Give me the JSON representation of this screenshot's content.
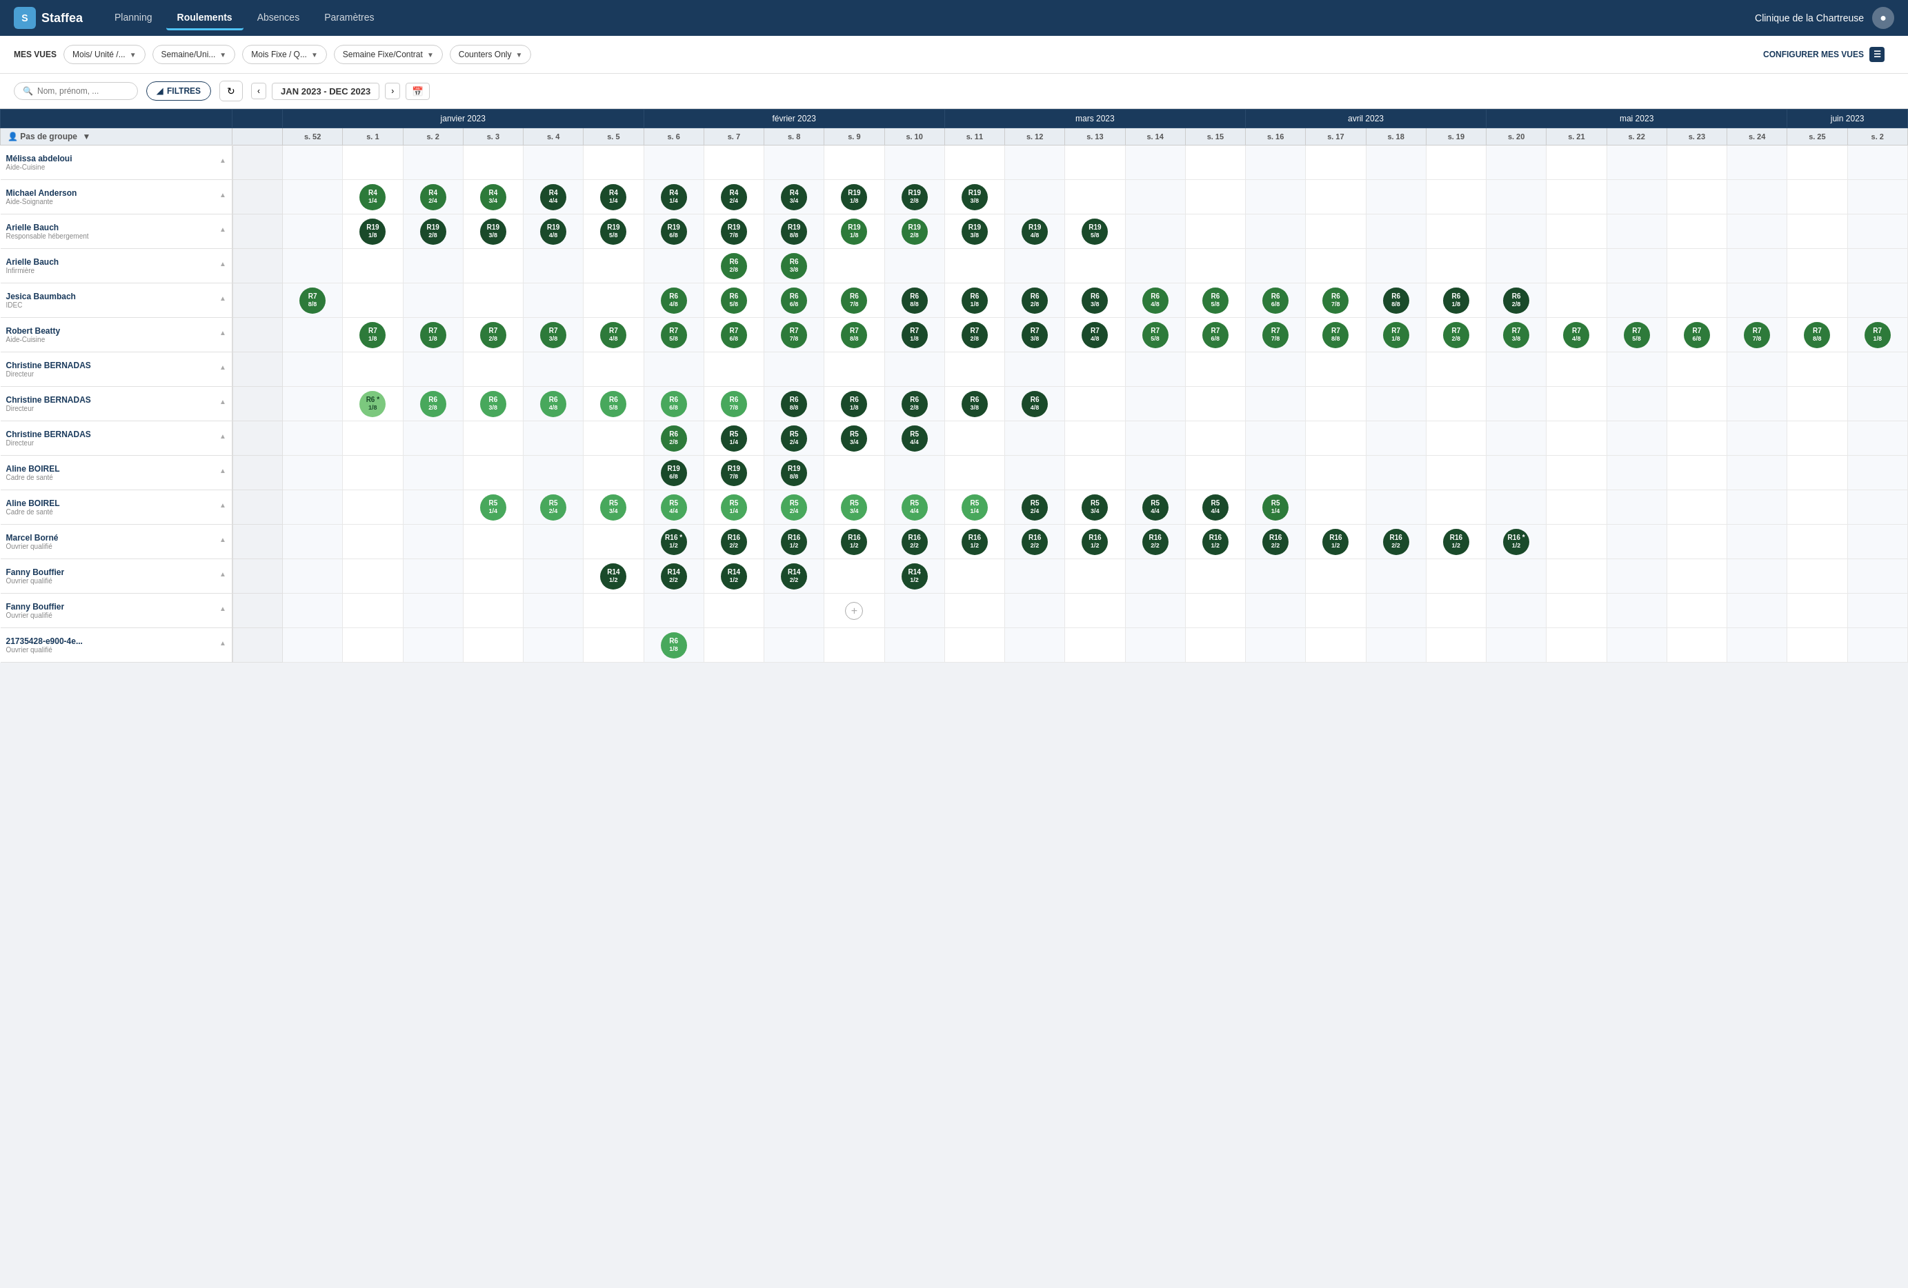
{
  "app": {
    "logo": "S",
    "logo_full": "Staffea"
  },
  "navbar": {
    "links": [
      "Planning",
      "Roulements",
      "Absences",
      "Paramètres"
    ],
    "active_link": "Roulements",
    "clinic": "Clinique de la Chartreuse"
  },
  "toolbar": {
    "label": "MES VUES",
    "dropdowns": [
      "Mois/ Unité /...",
      "Semaine/Uni...",
      "Mois Fixe / Q...",
      "Semaine Fixe/Contrat",
      "Counters Only"
    ],
    "configure_label": "CONFIGURER MES VUES"
  },
  "searchbar": {
    "placeholder": "Nom, prénom, ...",
    "filter_label": "FILTRES",
    "date_range": "JAN 2023 - DEC 2023"
  },
  "group": {
    "label": "Pas de groupe"
  },
  "months": [
    {
      "label": "janvier 2023",
      "span": 6
    },
    {
      "label": "février 2023",
      "span": 5
    },
    {
      "label": "mars 2023",
      "span": 5
    },
    {
      "label": "avril 2023",
      "span": 4
    },
    {
      "label": "mai 2023",
      "span": 5
    },
    {
      "label": "juin 2023",
      "span": 5
    }
  ],
  "weeks": [
    "s. 52",
    "s. 1",
    "s. 2",
    "s. 3",
    "s. 4",
    "s. 5",
    "s. 6",
    "s. 7",
    "s. 8",
    "s. 9",
    "s. 10",
    "s. 11",
    "s. 12",
    "s. 13",
    "s. 14",
    "s. 15",
    "s. 16",
    "s. 17",
    "s. 18",
    "s. 19",
    "s. 20",
    "s. 21",
    "s. 22",
    "s. 23",
    "s. 24",
    "s. 25",
    "s. 2"
  ],
  "employees": [
    {
      "name": "Mélissa abdeloui",
      "role": "Aide-Cuisine",
      "shifts": {}
    },
    {
      "name": "Michael Anderson",
      "role": "Aide-Soignante",
      "shifts": {
        "1": {
          "label": "R4",
          "frac": "1/4",
          "color": "medium"
        },
        "2": {
          "label": "R4",
          "frac": "2/4",
          "color": "medium"
        },
        "3": {
          "label": "R4",
          "frac": "3/4",
          "color": "medium"
        },
        "4": {
          "label": "R4",
          "frac": "4/4",
          "color": "dark"
        },
        "5": {
          "label": "R4",
          "frac": "1/4",
          "color": "dark"
        },
        "6": {
          "label": "R4",
          "frac": "1/4",
          "color": "dark"
        },
        "7": {
          "label": "R4",
          "frac": "2/4",
          "color": "dark"
        },
        "8": {
          "label": "R4",
          "frac": "3/4",
          "color": "dark"
        },
        "9": {
          "label": "R19",
          "frac": "1/8",
          "color": "dark"
        },
        "10": {
          "label": "R19",
          "frac": "2/8",
          "color": "dark"
        },
        "11": {
          "label": "R19",
          "frac": "3/8",
          "color": "dark"
        }
      }
    },
    {
      "name": "Arielle Bauch",
      "role": "Responsable hébergement",
      "shifts": {
        "1": {
          "label": "R19",
          "frac": "1/8",
          "color": "dark"
        },
        "2": {
          "label": "R19",
          "frac": "2/8",
          "color": "dark"
        },
        "3": {
          "label": "R19",
          "frac": "3/8",
          "color": "dark"
        },
        "4": {
          "label": "R19",
          "frac": "4/8",
          "color": "dark"
        },
        "5": {
          "label": "R19",
          "frac": "5/8",
          "color": "dark"
        },
        "6": {
          "label": "R19",
          "frac": "6/8",
          "color": "dark"
        },
        "7": {
          "label": "R19",
          "frac": "7/8",
          "color": "dark"
        },
        "8": {
          "label": "R19",
          "frac": "8/8",
          "color": "dark"
        },
        "9": {
          "label": "R19",
          "frac": "1/8",
          "color": "medium"
        },
        "10": {
          "label": "R19",
          "frac": "2/8",
          "color": "medium"
        },
        "11": {
          "label": "R19",
          "frac": "3/8",
          "color": "dark"
        },
        "12": {
          "label": "R19",
          "frac": "4/8",
          "color": "dark"
        },
        "13": {
          "label": "R19",
          "frac": "5/8",
          "color": "dark"
        }
      }
    },
    {
      "name": "Arielle Bauch",
      "role": "Infirmière",
      "shifts": {
        "7": {
          "label": "R6",
          "frac": "2/8",
          "color": "medium"
        },
        "8": {
          "label": "R6",
          "frac": "3/8",
          "color": "medium"
        }
      }
    },
    {
      "name": "Jesica Baumbach",
      "role": "IDEC",
      "shifts": {
        "0": {
          "label": "R7",
          "frac": "8/8",
          "color": "medium"
        },
        "6": {
          "label": "R6",
          "frac": "4/8",
          "color": "medium"
        },
        "7": {
          "label": "R6",
          "frac": "5/8",
          "color": "medium"
        },
        "8": {
          "label": "R6",
          "frac": "6/8",
          "color": "medium"
        },
        "9": {
          "label": "R6",
          "frac": "7/8",
          "color": "medium"
        },
        "10": {
          "label": "R6",
          "frac": "8/8",
          "color": "dark"
        },
        "11": {
          "label": "R6",
          "frac": "1/8",
          "color": "dark"
        },
        "12": {
          "label": "R6",
          "frac": "2/8",
          "color": "dark"
        },
        "13": {
          "label": "R6",
          "frac": "3/8",
          "color": "dark"
        },
        "14": {
          "label": "R6",
          "frac": "4/8",
          "color": "medium"
        },
        "15": {
          "label": "R6",
          "frac": "5/8",
          "color": "medium"
        },
        "16": {
          "label": "R6",
          "frac": "6/8",
          "color": "medium"
        },
        "17": {
          "label": "R6",
          "frac": "7/8",
          "color": "medium"
        },
        "18": {
          "label": "R6",
          "frac": "8/8",
          "color": "dark"
        },
        "19": {
          "label": "R6",
          "frac": "1/8",
          "color": "dark"
        },
        "20": {
          "label": "R6",
          "frac": "2/8",
          "color": "dark"
        }
      }
    },
    {
      "name": "Robert Beatty",
      "role": "Aide-Cuisine",
      "shifts": {
        "1": {
          "label": "R7",
          "frac": "1/8",
          "color": "medium"
        },
        "2": {
          "label": "R7",
          "frac": "1/8",
          "color": "medium"
        },
        "3": {
          "label": "R7",
          "frac": "2/8",
          "color": "medium"
        },
        "4": {
          "label": "R7",
          "frac": "3/8",
          "color": "medium"
        },
        "5": {
          "label": "R7",
          "frac": "4/8",
          "color": "medium"
        },
        "6": {
          "label": "R7",
          "frac": "5/8",
          "color": "medium"
        },
        "7": {
          "label": "R7",
          "frac": "6/8",
          "color": "medium"
        },
        "8": {
          "label": "R7",
          "frac": "7/8",
          "color": "medium"
        },
        "9": {
          "label": "R7",
          "frac": "8/8",
          "color": "medium"
        },
        "10": {
          "label": "R7",
          "frac": "1/8",
          "color": "dark"
        },
        "11": {
          "label": "R7",
          "frac": "2/8",
          "color": "dark"
        },
        "12": {
          "label": "R7",
          "frac": "3/8",
          "color": "dark"
        },
        "13": {
          "label": "R7",
          "frac": "4/8",
          "color": "dark"
        },
        "14": {
          "label": "R7",
          "frac": "5/8",
          "color": "medium"
        },
        "15": {
          "label": "R7",
          "frac": "6/8",
          "color": "medium"
        },
        "16": {
          "label": "R7",
          "frac": "7/8",
          "color": "medium"
        },
        "17": {
          "label": "R7",
          "frac": "8/8",
          "color": "medium"
        },
        "18": {
          "label": "R7",
          "frac": "1/8",
          "color": "medium"
        },
        "19": {
          "label": "R7",
          "frac": "2/8",
          "color": "medium"
        },
        "20": {
          "label": "R7",
          "frac": "3/8",
          "color": "medium"
        },
        "21": {
          "label": "R7",
          "frac": "4/8",
          "color": "medium"
        },
        "22": {
          "label": "R7",
          "frac": "5/8",
          "color": "medium"
        },
        "23": {
          "label": "R7",
          "frac": "6/8",
          "color": "medium"
        },
        "24": {
          "label": "R7",
          "frac": "7/8",
          "color": "medium"
        },
        "25": {
          "label": "R7",
          "frac": "8/8",
          "color": "medium"
        },
        "26": {
          "label": "R7",
          "frac": "1/8",
          "color": "medium"
        }
      }
    },
    {
      "name": "Christine BERNADAS",
      "role": "Directeur",
      "shifts": {}
    },
    {
      "name": "Christine BERNADAS",
      "role": "Directeur",
      "shifts": {
        "1": {
          "label": "R6 *",
          "frac": "1/8",
          "color": "lighter"
        },
        "2": {
          "label": "R6",
          "frac": "2/8",
          "color": "light"
        },
        "3": {
          "label": "R6",
          "frac": "3/8",
          "color": "light"
        },
        "4": {
          "label": "R6",
          "frac": "4/8",
          "color": "light"
        },
        "5": {
          "label": "R6",
          "frac": "5/8",
          "color": "light"
        },
        "6": {
          "label": "R6",
          "frac": "6/8",
          "color": "light"
        },
        "7": {
          "label": "R6",
          "frac": "7/8",
          "color": "light"
        },
        "8": {
          "label": "R6",
          "frac": "8/8",
          "color": "dark"
        },
        "9": {
          "label": "R6",
          "frac": "1/8",
          "color": "dark"
        },
        "10": {
          "label": "R6",
          "frac": "2/8",
          "color": "dark"
        },
        "11": {
          "label": "R6",
          "frac": "3/8",
          "color": "dark"
        },
        "12": {
          "label": "R6",
          "frac": "4/8",
          "color": "dark"
        }
      }
    },
    {
      "name": "Christine BERNADAS",
      "role": "Directeur",
      "shifts": {
        "6": {
          "label": "R6",
          "frac": "2/8",
          "color": "medium"
        },
        "7": {
          "label": "R5",
          "frac": "1/4",
          "color": "dark"
        },
        "8": {
          "label": "R5",
          "frac": "2/4",
          "color": "dark"
        },
        "9": {
          "label": "R5",
          "frac": "3/4",
          "color": "dark"
        },
        "10": {
          "label": "R5",
          "frac": "4/4",
          "color": "dark"
        }
      }
    },
    {
      "name": "Aline BOIREL",
      "role": "Cadre de santé",
      "shifts": {
        "6": {
          "label": "R19",
          "frac": "6/8",
          "color": "dark"
        },
        "7": {
          "label": "R19",
          "frac": "7/8",
          "color": "dark"
        },
        "8": {
          "label": "R19",
          "frac": "8/8",
          "color": "dark"
        }
      }
    },
    {
      "name": "Aline BOIREL",
      "role": "Cadre de santé",
      "shifts": {
        "3": {
          "label": "R5",
          "frac": "1/4",
          "color": "light"
        },
        "4": {
          "label": "R5",
          "frac": "2/4",
          "color": "light"
        },
        "5": {
          "label": "R5",
          "frac": "3/4",
          "color": "light"
        },
        "6": {
          "label": "R5",
          "frac": "4/4",
          "color": "light"
        },
        "7": {
          "label": "R5",
          "frac": "1/4",
          "color": "light"
        },
        "8": {
          "label": "R5",
          "frac": "2/4",
          "color": "light"
        },
        "9": {
          "label": "R5",
          "frac": "3/4",
          "color": "light"
        },
        "10": {
          "label": "R5",
          "frac": "4/4",
          "color": "light"
        },
        "11": {
          "label": "R5",
          "frac": "1/4",
          "color": "light"
        },
        "12": {
          "label": "R5",
          "frac": "2/4",
          "color": "dark"
        },
        "13": {
          "label": "R5",
          "frac": "3/4",
          "color": "dark"
        },
        "14": {
          "label": "R5",
          "frac": "4/4",
          "color": "dark"
        },
        "15": {
          "label": "R5",
          "frac": "4/4",
          "color": "dark"
        },
        "16": {
          "label": "R5",
          "frac": "1/4",
          "color": "medium"
        }
      }
    },
    {
      "name": "Marcel Borné",
      "role": "Ouvrier qualifié",
      "shifts": {
        "6": {
          "label": "R16 *",
          "frac": "1/2",
          "color": "dark"
        },
        "7": {
          "label": "R16",
          "frac": "2/2",
          "color": "dark"
        },
        "8": {
          "label": "R16",
          "frac": "1/2",
          "color": "dark"
        },
        "9": {
          "label": "R16",
          "frac": "1/2",
          "color": "dark"
        },
        "10": {
          "label": "R16",
          "frac": "2/2",
          "color": "dark"
        },
        "11": {
          "label": "R16",
          "frac": "1/2",
          "color": "dark"
        },
        "12": {
          "label": "R16",
          "frac": "2/2",
          "color": "dark"
        },
        "13": {
          "label": "R16",
          "frac": "1/2",
          "color": "dark"
        },
        "14": {
          "label": "R16",
          "frac": "2/2",
          "color": "dark"
        },
        "15": {
          "label": "R16",
          "frac": "1/2",
          "color": "dark"
        },
        "16": {
          "label": "R16",
          "frac": "2/2",
          "color": "dark"
        },
        "17": {
          "label": "R16",
          "frac": "1/2",
          "color": "dark"
        },
        "18": {
          "label": "R16",
          "frac": "2/2",
          "color": "dark"
        },
        "19": {
          "label": "R16",
          "frac": "1/2",
          "color": "dark"
        },
        "20": {
          "label": "R16 *",
          "frac": "1/2",
          "color": "dark"
        }
      }
    },
    {
      "name": "Fanny Bouffier",
      "role": "Ouvrier qualifié",
      "shifts": {
        "5": {
          "label": "R14",
          "frac": "1/2",
          "color": "dark"
        },
        "6": {
          "label": "R14",
          "frac": "2/2",
          "color": "dark"
        },
        "7": {
          "label": "R14",
          "frac": "1/2",
          "color": "dark"
        },
        "8": {
          "label": "R14",
          "frac": "2/2",
          "color": "dark"
        },
        "10": {
          "label": "R14",
          "frac": "1/2",
          "color": "dark"
        }
      }
    },
    {
      "name": "Fanny Bouffier",
      "role": "Ouvrier qualifié",
      "shifts": {
        "9": {
          "plus": true
        }
      }
    },
    {
      "name": "21735428-e900-4e...",
      "role": "Ouvrier qualifié",
      "shifts": {
        "6": {
          "label": "R6",
          "frac": "1/8",
          "color": "light"
        }
      }
    }
  ],
  "colors": {
    "dark": "#1a4a2a",
    "medium": "#2d7a3a",
    "light": "#48a85c",
    "lighter": "#7cc87e",
    "navy": "#1a3a5c"
  }
}
